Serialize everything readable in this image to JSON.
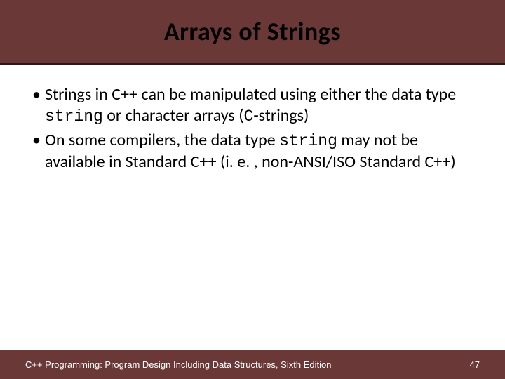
{
  "title": "Arrays of Strings",
  "bullets": [
    {
      "pre1": "Strings in C++ can be manipulated using either the data type ",
      "code1": "string",
      "mid1": " or character arrays (",
      "code2": "C",
      "post1": "-strings)"
    },
    {
      "pre1": "On some compilers, the data type ",
      "code1": "string",
      "mid1": " may not be available in Standard C++ (i. e. , non-ANSI/ISO Standard C++)",
      "code2": "",
      "post1": ""
    }
  ],
  "footer": {
    "left": "C++ Programming: Program Design Including Data Structures, Sixth Edition",
    "page": "47"
  }
}
